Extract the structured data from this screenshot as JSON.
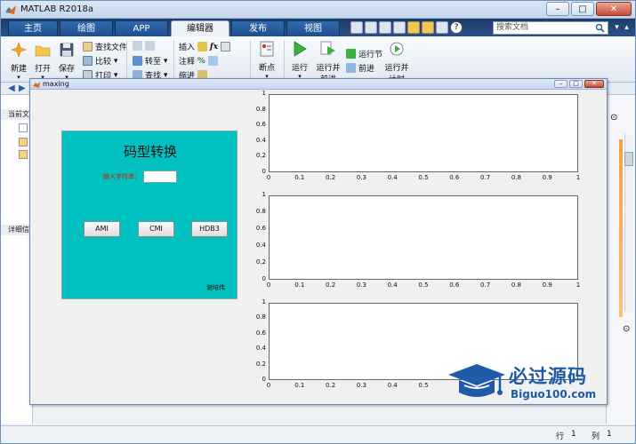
{
  "app": {
    "title": "MATLAB R2018a",
    "search_placeholder": "搜索文档"
  },
  "tabs": [
    "主页",
    "绘图",
    "APP",
    "编辑器",
    "发布",
    "视图"
  ],
  "active_tab": "编辑器",
  "ribbon": {
    "new": "新建",
    "open": "打开",
    "save": "保存",
    "find_files": "查找文件",
    "compare": "比较",
    "print": "打印",
    "goto": "转至",
    "find": "查找",
    "insert": "插入",
    "comment": "注释",
    "indent": "缩进",
    "breakpoints": "断点",
    "run": "运行",
    "run_advance": "运行并",
    "run_advance_2": "前进",
    "run_section": "运行节",
    "advance": "前进",
    "run_time": "运行并",
    "run_time_2": "计时"
  },
  "left_panel": {
    "current_folder": "当前文",
    "details": "详细信"
  },
  "status_bar": {
    "row_label": "行",
    "row_value": "1",
    "col_label": "列",
    "col_value": "1"
  },
  "figure": {
    "title": "maxing",
    "panel": {
      "title": "码型转换",
      "input_label": "输入字符串：",
      "input_value": "",
      "buttons": [
        "AMI",
        "CMI",
        "HDB3"
      ],
      "author": "谢培伟"
    },
    "axes": {
      "y_ticks": [
        "1",
        "0.8",
        "0.6",
        "0.4",
        "0.2",
        "0"
      ],
      "x_ticks": [
        "0",
        "0.1",
        "0.2",
        "0.3",
        "0.4",
        "0.5",
        "0.6",
        "0.7",
        "0.8",
        "0.9",
        "1"
      ],
      "third_x_ticks": [
        "0",
        "0.1",
        "0.2",
        "0.3",
        "0.4",
        "0.5"
      ]
    }
  },
  "watermark": {
    "title": "必过源码",
    "url": "Biguo100.com"
  },
  "colors": {
    "panel_bg": "#00c0c0",
    "label_red": "#cc2200",
    "tab_blue": "#1f4f8e",
    "watermark_blue": "#1e5aa8"
  }
}
